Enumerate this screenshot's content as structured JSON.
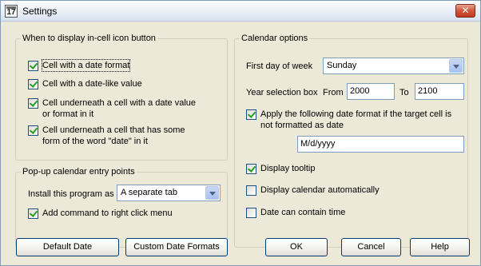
{
  "window": {
    "title": "Settings",
    "icon_glyph": "17",
    "close_glyph": "✕"
  },
  "incell": {
    "legend": "When to display in-cell icon button",
    "items": [
      {
        "label": "Cell with a date format",
        "checked": true
      },
      {
        "label": "Cell with a date-like value",
        "checked": true
      },
      {
        "label": "Cell underneath a cell with a date value or format in it",
        "checked": true
      },
      {
        "label": "Cell underneath a cell that has some form of the word \"date\" in it",
        "checked": true
      }
    ]
  },
  "popup": {
    "legend": "Pop-up calendar entry points",
    "install_label": "Install this program as",
    "install_value": "A separate tab",
    "add_command_label": "Add command to right click menu",
    "add_command_checked": true
  },
  "calendar": {
    "legend": "Calendar options",
    "first_day_label": "First day of week",
    "first_day_value": "Sunday",
    "year_box_label": "Year selection box",
    "from_label": "From",
    "from_value": "2000",
    "to_label": "To",
    "to_value": "2100",
    "apply_format_label": "Apply the following date format if the target cell is not formatted as date",
    "apply_format_checked": true,
    "date_format_value": "M/d/yyyy",
    "display_tooltip_label": "Display tooltip",
    "display_tooltip_checked": true,
    "display_auto_label": "Display calendar automatically",
    "display_auto_checked": false,
    "date_time_label": "Date can contain time",
    "date_time_checked": false
  },
  "buttons": {
    "default_date": "Default Date",
    "custom_formats": "Custom Date Formats",
    "ok": "OK",
    "cancel": "Cancel",
    "help": "Help"
  },
  "colors": {
    "dialog_bg": "#ece9d8",
    "check_green": "#21a121",
    "close_red": "#c23a1f"
  }
}
